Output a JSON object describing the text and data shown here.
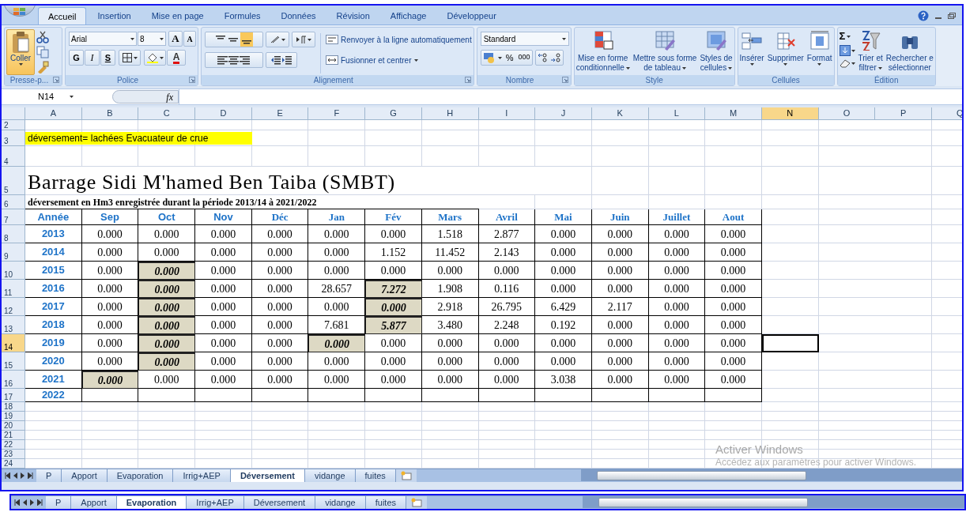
{
  "ribbon": {
    "tabs": [
      {
        "label": "Accueil",
        "selected": true
      },
      {
        "label": "Insertion",
        "selected": false
      },
      {
        "label": "Mise en page",
        "selected": false
      },
      {
        "label": "Formules",
        "selected": false
      },
      {
        "label": "Données",
        "selected": false
      },
      {
        "label": "Révision",
        "selected": false
      },
      {
        "label": "Affichage",
        "selected": false
      },
      {
        "label": "Développeur",
        "selected": false
      }
    ],
    "groups": [
      {
        "kind": "clipboard",
        "label": "Presse-p...",
        "paste": "Coller"
      },
      {
        "kind": "font",
        "label": "Police",
        "font_name": "Arial",
        "font_size": "8",
        "grow": "A",
        "shrink": "A",
        "bold": "G",
        "italic": "I",
        "underline": "S",
        "font_color": "A"
      },
      {
        "kind": "alignment",
        "label": "Alignement",
        "wrap": "Renvoyer à la ligne automatiquement",
        "merge": "Fusionner et centrer"
      },
      {
        "kind": "number",
        "label": "Nombre",
        "format": "Standard",
        "percent": "%",
        "thousands": "000"
      },
      {
        "kind": "large",
        "label": "Style",
        "buttons": [
          {
            "lines": [
              "Mise en forme",
              "conditionnelle"
            ]
          },
          {
            "lines": [
              "Mettre sous forme",
              "de tableau"
            ]
          },
          {
            "lines": [
              "Styles de",
              "cellules"
            ]
          }
        ]
      },
      {
        "kind": "large",
        "label": "Cellules",
        "buttons": [
          {
            "lines": [
              "Insérer"
            ]
          },
          {
            "lines": [
              "Supprimer"
            ]
          },
          {
            "lines": [
              "Format"
            ]
          }
        ]
      },
      {
        "kind": "edition",
        "label": "Édition",
        "sum": "Σ",
        "buttons": [
          {
            "lines": [
              "Trier et",
              "filtrer"
            ]
          },
          {
            "lines": [
              "Rechercher e",
              "sélectionner"
            ]
          }
        ]
      }
    ]
  },
  "formula_bar": {
    "name_box": "N14",
    "fx": "fx"
  },
  "sheet": {
    "columns": [
      {
        "label": "A",
        "selected": false
      },
      {
        "label": "B",
        "selected": false
      },
      {
        "label": "C",
        "selected": false
      },
      {
        "label": "D",
        "selected": false
      },
      {
        "label": "E",
        "selected": false
      },
      {
        "label": "F",
        "selected": false
      },
      {
        "label": "G",
        "selected": false
      },
      {
        "label": "H",
        "selected": false
      },
      {
        "label": "I",
        "selected": false
      },
      {
        "label": "J",
        "selected": false
      },
      {
        "label": "K",
        "selected": false
      },
      {
        "label": "L",
        "selected": false
      },
      {
        "label": "M",
        "selected": false
      },
      {
        "label": "N",
        "selected": true
      },
      {
        "label": "O",
        "selected": false
      },
      {
        "label": "P",
        "selected": false
      },
      {
        "label": "Q",
        "selected": false
      }
    ],
    "rows": [
      {
        "label": "2",
        "selected": false
      },
      {
        "label": "3",
        "selected": false
      },
      {
        "label": "4",
        "selected": false
      },
      {
        "label": "5",
        "selected": false
      },
      {
        "label": "6",
        "selected": false
      },
      {
        "label": "7",
        "selected": false
      },
      {
        "label": "8",
        "selected": false
      },
      {
        "label": "9",
        "selected": false
      },
      {
        "label": "10",
        "selected": false
      },
      {
        "label": "11",
        "selected": false
      },
      {
        "label": "12",
        "selected": false
      },
      {
        "label": "13",
        "selected": false
      },
      {
        "label": "14",
        "selected": true
      },
      {
        "label": "15",
        "selected": false
      },
      {
        "label": "16",
        "selected": false
      },
      {
        "label": "17",
        "selected": false
      },
      {
        "label": "18",
        "selected": false
      },
      {
        "label": "19",
        "selected": false
      },
      {
        "label": "20",
        "selected": false
      },
      {
        "label": "21",
        "selected": false
      },
      {
        "label": "22",
        "selected": false
      },
      {
        "label": "23",
        "selected": false
      },
      {
        "label": "24",
        "selected": false
      }
    ],
    "note": "déversement= lachées Evacuateur de crue",
    "title": "Barrage Sidi M'hamed Ben Taiba (SMBT)",
    "subtitle": "déversement en Hm3 enregistrée durant la période 2013/14 à 2021/2022",
    "table": {
      "columns": [
        "Année",
        "Sep",
        "Oct",
        "Nov",
        "Déc",
        "Jan",
        "Fév",
        "Mars",
        "Avril",
        "Mai",
        "Juin",
        "Juillet",
        "Aout"
      ],
      "rows": [
        {
          "year": "2013",
          "cells": [
            {
              "text": "0.000",
              "flagged": false
            },
            {
              "text": "0.000",
              "flagged": false
            },
            {
              "text": "0.000",
              "flagged": false
            },
            {
              "text": "0.000",
              "flagged": false
            },
            {
              "text": "0.000",
              "flagged": false
            },
            {
              "text": "0.000",
              "flagged": false
            },
            {
              "text": "1.518",
              "flagged": false
            },
            {
              "text": "2.877",
              "flagged": false
            },
            {
              "text": "0.000",
              "flagged": false
            },
            {
              "text": "0.000",
              "flagged": false
            },
            {
              "text": "0.000",
              "flagged": false
            },
            {
              "text": "0.000",
              "flagged": false
            }
          ]
        },
        {
          "year": "2014",
          "cells": [
            {
              "text": "0.000",
              "flagged": false
            },
            {
              "text": "0.000",
              "flagged": false
            },
            {
              "text": "0.000",
              "flagged": false
            },
            {
              "text": "0.000",
              "flagged": false
            },
            {
              "text": "0.000",
              "flagged": false
            },
            {
              "text": "1.152",
              "flagged": false
            },
            {
              "text": "11.452",
              "flagged": false
            },
            {
              "text": "2.143",
              "flagged": false
            },
            {
              "text": "0.000",
              "flagged": false
            },
            {
              "text": "0.000",
              "flagged": false
            },
            {
              "text": "0.000",
              "flagged": false
            },
            {
              "text": "0.000",
              "flagged": false
            }
          ]
        },
        {
          "year": "2015",
          "cells": [
            {
              "text": "0.000",
              "flagged": false
            },
            {
              "text": "0.000",
              "flagged": true
            },
            {
              "text": "0.000",
              "flagged": false
            },
            {
              "text": "0.000",
              "flagged": false
            },
            {
              "text": "0.000",
              "flagged": false
            },
            {
              "text": "0.000",
              "flagged": false
            },
            {
              "text": "0.000",
              "flagged": false
            },
            {
              "text": "0.000",
              "flagged": false
            },
            {
              "text": "0.000",
              "flagged": false
            },
            {
              "text": "0.000",
              "flagged": false
            },
            {
              "text": "0.000",
              "flagged": false
            },
            {
              "text": "0.000",
              "flagged": false
            }
          ]
        },
        {
          "year": "2016",
          "cells": [
            {
              "text": "0.000",
              "flagged": false
            },
            {
              "text": "0.000",
              "flagged": true
            },
            {
              "text": "0.000",
              "flagged": false
            },
            {
              "text": "0.000",
              "flagged": false
            },
            {
              "text": "28.657",
              "flagged": false
            },
            {
              "text": "7.272",
              "flagged": true
            },
            {
              "text": "1.908",
              "flagged": false
            },
            {
              "text": "0.116",
              "flagged": false
            },
            {
              "text": "0.000",
              "flagged": false
            },
            {
              "text": "0.000",
              "flagged": false
            },
            {
              "text": "0.000",
              "flagged": false
            },
            {
              "text": "0.000",
              "flagged": false
            }
          ]
        },
        {
          "year": "2017",
          "cells": [
            {
              "text": "0.000",
              "flagged": false
            },
            {
              "text": "0.000",
              "flagged": true
            },
            {
              "text": "0.000",
              "flagged": false
            },
            {
              "text": "0.000",
              "flagged": false
            },
            {
              "text": "0.000",
              "flagged": false
            },
            {
              "text": "0.000",
              "flagged": true
            },
            {
              "text": "2.918",
              "flagged": false
            },
            {
              "text": "26.795",
              "flagged": false
            },
            {
              "text": "6.429",
              "flagged": false
            },
            {
              "text": "2.117",
              "flagged": false
            },
            {
              "text": "0.000",
              "flagged": false
            },
            {
              "text": "0.000",
              "flagged": false
            }
          ]
        },
        {
          "year": "2018",
          "cells": [
            {
              "text": "0.000",
              "flagged": false
            },
            {
              "text": "0.000",
              "flagged": true
            },
            {
              "text": "0.000",
              "flagged": false
            },
            {
              "text": "0.000",
              "flagged": false
            },
            {
              "text": "7.681",
              "flagged": false
            },
            {
              "text": "5.877",
              "flagged": true
            },
            {
              "text": "3.480",
              "flagged": false
            },
            {
              "text": "2.248",
              "flagged": false
            },
            {
              "text": "0.192",
              "flagged": false
            },
            {
              "text": "0.000",
              "flagged": false
            },
            {
              "text": "0.000",
              "flagged": false
            },
            {
              "text": "0.000",
              "flagged": false
            }
          ]
        },
        {
          "year": "2019",
          "cells": [
            {
              "text": "0.000",
              "flagged": false
            },
            {
              "text": "0.000",
              "flagged": true
            },
            {
              "text": "0.000",
              "flagged": false
            },
            {
              "text": "0.000",
              "flagged": false
            },
            {
              "text": "0.000",
              "flagged": true
            },
            {
              "text": "0.000",
              "flagged": false
            },
            {
              "text": "0.000",
              "flagged": false
            },
            {
              "text": "0.000",
              "flagged": false
            },
            {
              "text": "0.000",
              "flagged": false
            },
            {
              "text": "0.000",
              "flagged": false
            },
            {
              "text": "0.000",
              "flagged": false
            },
            {
              "text": "0.000",
              "flagged": false
            }
          ]
        },
        {
          "year": "2020",
          "cells": [
            {
              "text": "0.000",
              "flagged": false
            },
            {
              "text": "0.000",
              "flagged": true
            },
            {
              "text": "0.000",
              "flagged": false
            },
            {
              "text": "0.000",
              "flagged": false
            },
            {
              "text": "0.000",
              "flagged": false
            },
            {
              "text": "0.000",
              "flagged": false
            },
            {
              "text": "0.000",
              "flagged": false
            },
            {
              "text": "0.000",
              "flagged": false
            },
            {
              "text": "0.000",
              "flagged": false
            },
            {
              "text": "0.000",
              "flagged": false
            },
            {
              "text": "0.000",
              "flagged": false
            },
            {
              "text": "0.000",
              "flagged": false
            }
          ]
        },
        {
          "year": "2021",
          "cells": [
            {
              "text": "0.000",
              "flagged": true
            },
            {
              "text": "0.000",
              "flagged": false
            },
            {
              "text": "0.000",
              "flagged": false
            },
            {
              "text": "0.000",
              "flagged": false
            },
            {
              "text": "0.000",
              "flagged": false
            },
            {
              "text": "0.000",
              "flagged": false
            },
            {
              "text": "0.000",
              "flagged": false
            },
            {
              "text": "0.000",
              "flagged": false
            },
            {
              "text": "3.038",
              "flagged": false
            },
            {
              "text": "0.000",
              "flagged": false
            },
            {
              "text": "0.000",
              "flagged": false
            },
            {
              "text": "0.000",
              "flagged": false
            }
          ]
        },
        {
          "year": "2022"
        }
      ]
    }
  },
  "sheet_tabs": [
    {
      "label": "P",
      "selected": false
    },
    {
      "label": "Apport",
      "selected": false
    },
    {
      "label": "Evaporation",
      "selected": false
    },
    {
      "label": "Irrig+AEP",
      "selected": false
    },
    {
      "label": "Déversement",
      "selected": true
    },
    {
      "label": "vidange",
      "selected": false
    },
    {
      "label": "fuites",
      "selected": false
    }
  ],
  "activation_notice": {
    "title": "Activer Windows",
    "message": "Accédez aux paramètres pour activer Windows."
  },
  "second_window": {
    "sheet_tabs": [
      {
        "label": "P",
        "selected": false
      },
      {
        "label": "Apport",
        "selected": false
      },
      {
        "label": "Evaporation",
        "selected": true
      },
      {
        "label": "Irrig+AEP",
        "selected": false
      },
      {
        "label": "Déversement",
        "selected": false
      },
      {
        "label": "vidange",
        "selected": false
      },
      {
        "label": "fuites",
        "selected": false
      }
    ]
  }
}
